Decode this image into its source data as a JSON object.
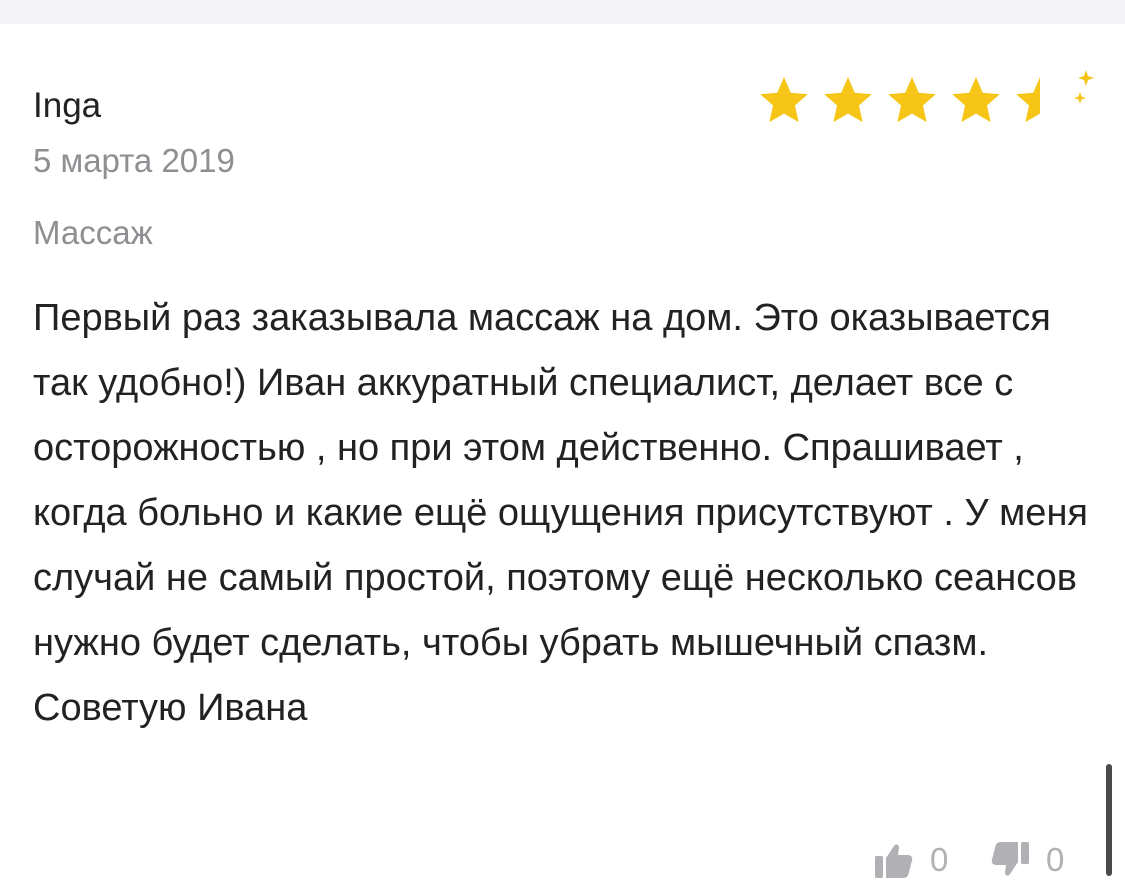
{
  "review": {
    "author": "Inga",
    "date": "5 марта 2019",
    "service": "Массаж",
    "rating": 4.5,
    "rating_max": 5,
    "text": "Первый раз заказывала массаж на дом. Это оказывается так удобно!) Иван аккуратный специалист, делает все с осторожностью , но при этом действенно. Спрашивает , когда больно и какие ещё ощущения присутствуют . У меня случай не самый простой, поэтому ещё несколько сеансов нужно будет сделать, чтобы убрать мышечный спазм. Советую Ивана",
    "likes": "0",
    "dislikes": "0"
  },
  "colors": {
    "star": "#f5c518",
    "text": "#222222",
    "muted": "#8e8e93",
    "vote": "#b0b0b5"
  },
  "icons": {
    "rating": "star-icon",
    "like": "thumbs-up-icon",
    "dislike": "thumbs-down-icon"
  }
}
